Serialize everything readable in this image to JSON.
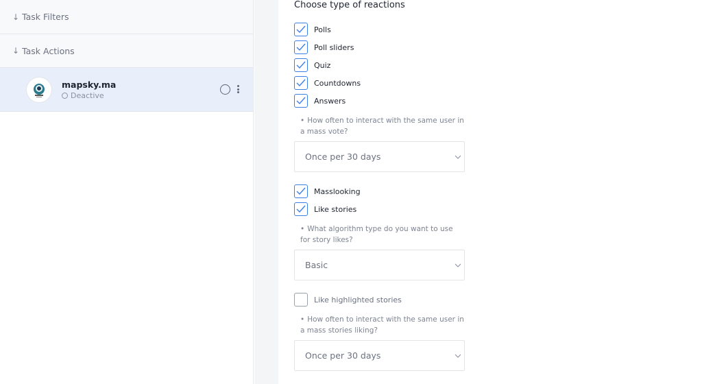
{
  "sidebar": {
    "sections": [
      {
        "label": "Task Filters"
      },
      {
        "label": "Task Actions"
      }
    ],
    "account": {
      "name": "mapsky.ma",
      "status": "Deactive"
    }
  },
  "main": {
    "title": "Choose type of reactions",
    "reactions": [
      {
        "label": "Polls",
        "checked": true
      },
      {
        "label": "Poll sliders",
        "checked": true
      },
      {
        "label": "Quiz",
        "checked": true
      },
      {
        "label": "Countdowns",
        "checked": true
      },
      {
        "label": "Answers",
        "checked": true
      }
    ],
    "mass_vote_hint": "How often to interact with the same user in a mass vote?",
    "mass_vote_select": "Once per 30 days",
    "masslooking": {
      "label": "Masslooking",
      "checked": true
    },
    "like_stories": {
      "label": "Like stories",
      "checked": true
    },
    "algorithm_hint": "What algorithm type do you want to use for story likes?",
    "algorithm_select": "Basic",
    "like_highlighted": {
      "label": "Like highlighted stories",
      "checked": false
    },
    "stories_hint": "How often to interact with the same user in a mass stories liking?",
    "stories_select": "Once per 30 days"
  },
  "colors": {
    "accent": "#3b80e6",
    "selected_row": "#e8effb"
  }
}
